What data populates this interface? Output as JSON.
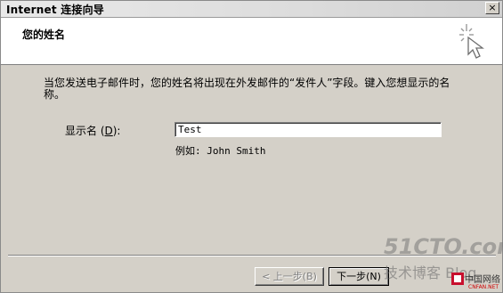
{
  "window": {
    "title": "Internet 连接向导",
    "close_glyph": "×"
  },
  "header": {
    "title": "您的姓名",
    "icon": "wizard-sparkle-cursor-icon"
  },
  "description": "当您发送电子邮件时，您的姓名将出现在外发邮件的“发件人”字段。键入您想显示的名称。",
  "display_name": {
    "label_prefix": "显示名 (",
    "label_hotkey": "D",
    "label_suffix": "):",
    "value": "Test",
    "example": "例如: John Smith"
  },
  "buttons": {
    "back": "< 上一步(B)",
    "next": "下一步(N)"
  },
  "watermarks": {
    "site": "51CTO.com",
    "blog": "技术博客 Blog",
    "cnfan": "中国网络",
    "cnfan_url": "CNFAN.NET"
  }
}
